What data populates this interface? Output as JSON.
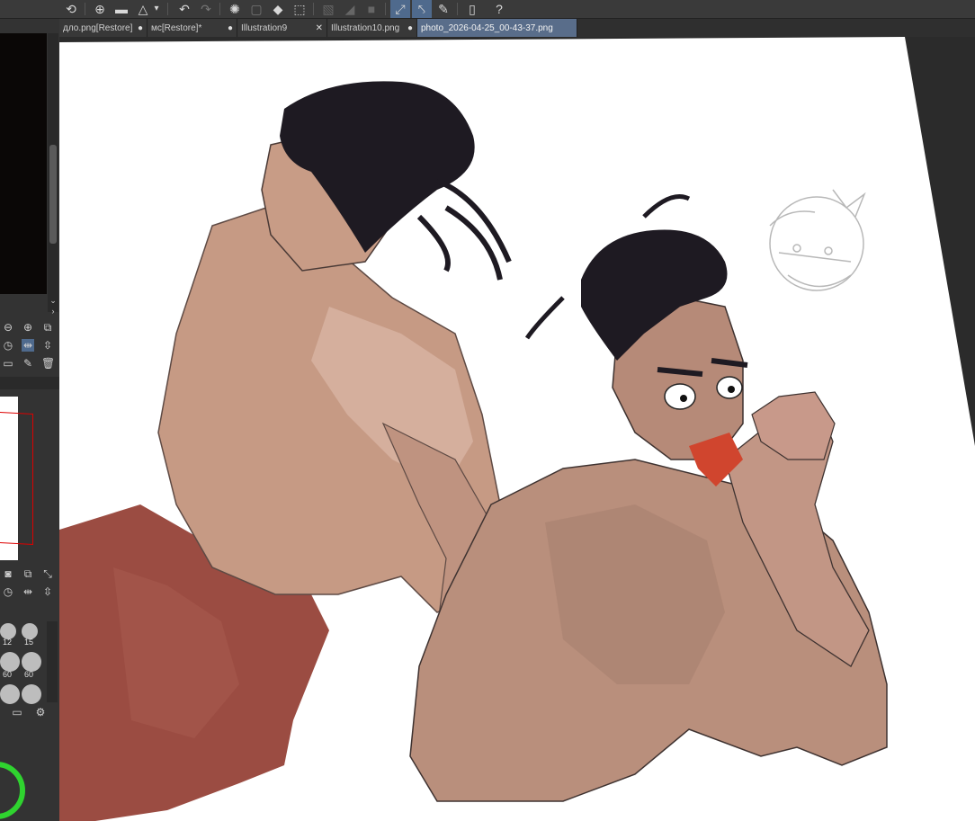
{
  "toolbar": {
    "icons": [
      "app-logo-icon",
      "new-file-icon",
      "open-folder-icon",
      "save-icon",
      "dropdown-icon",
      "undo-icon",
      "redo-icon",
      "loading-icon",
      "clear-icon",
      "fill-icon",
      "transform-icon",
      "grid-icon",
      "ruler-icon",
      "snap-icon",
      "snap-ruler-icon",
      "snap-curve-icon",
      "pen-ruler-icon",
      "device-icon",
      "help-icon"
    ]
  },
  "tabs": [
    {
      "label": "дло.png[Restore]",
      "mark": "●"
    },
    {
      "label": "мс[Restore]*",
      "mark": "●"
    },
    {
      "label": "Illustration9",
      "mark": "✕"
    },
    {
      "label": "Illustration10.png",
      "mark": "●"
    },
    {
      "label": "photo_2026-04-25_00-43-37.png",
      "mark": ""
    }
  ],
  "left_panel": {
    "brush_sizes": [
      "12",
      "15",
      "60",
      "60"
    ]
  },
  "colors": {
    "ui_bg": "#2b2b2b",
    "toolbar_bg": "#3a3a3a",
    "active_tab": "#596d8a",
    "skin": "#c49a82",
    "hair": "#1e1a22",
    "fabric": "#9a4a40",
    "wheel_green": "#2fd32f"
  }
}
